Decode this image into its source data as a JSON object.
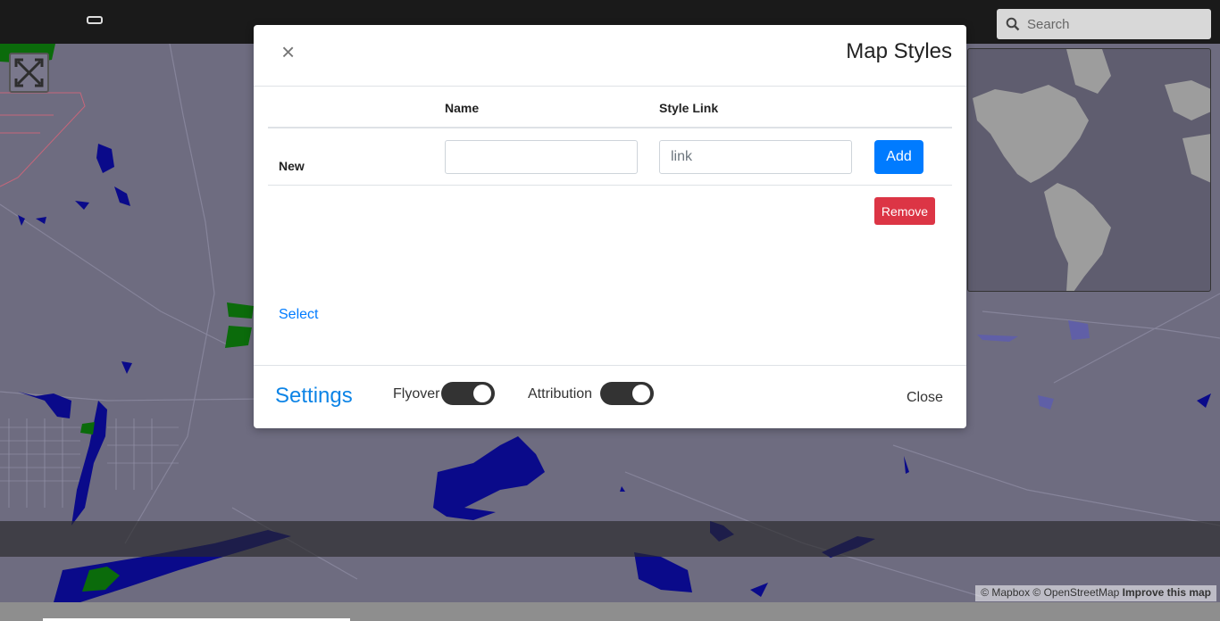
{
  "topbar": {
    "menu_icon": "hamburger-icon",
    "search": {
      "placeholder": "Search",
      "icon": "search-icon"
    }
  },
  "map": {
    "fullscreen_icon": "fullscreen-icon",
    "attribution": {
      "text": "© Mapbox © OpenStreetMap",
      "improve": "Improve this map"
    },
    "colors": {
      "land": "#6e6c80",
      "water": "#0a0a8a",
      "park": "#0b6b0b",
      "road": "#8a8898"
    }
  },
  "modal": {
    "close_icon": "×",
    "title": "Map Styles",
    "table": {
      "columns": [
        "",
        "Name",
        "Style Link"
      ],
      "new_row": {
        "label": "New",
        "name_value": "",
        "link_placeholder": "link",
        "add_label": "Add"
      },
      "remove_label": "Remove"
    },
    "select_label": "Select",
    "footer": {
      "settings_title": "Settings",
      "toggles": [
        {
          "label": "Flyover",
          "on": true
        },
        {
          "label": "Attribution",
          "on": true
        }
      ],
      "close_label": "Close"
    },
    "colors": {
      "primary": "#007bff",
      "danger": "#dc3545",
      "settings": "#0d84e6"
    }
  }
}
